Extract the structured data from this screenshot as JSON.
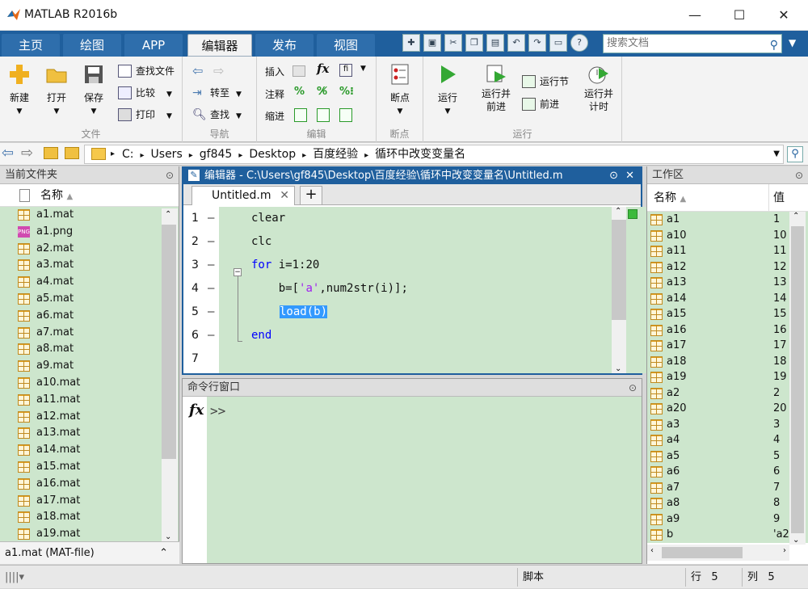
{
  "window": {
    "title": "MATLAB R2016b",
    "minimize": "—",
    "maximize": "☐",
    "close": "✕"
  },
  "tabs": [
    {
      "label": "主页"
    },
    {
      "label": "绘图"
    },
    {
      "label": "APP"
    },
    {
      "label": "编辑器",
      "active": true
    },
    {
      "label": "发布"
    },
    {
      "label": "视图"
    }
  ],
  "search": {
    "placeholder": "搜索文档"
  },
  "ribbon": {
    "file": {
      "section": "文件",
      "new": "新建",
      "open": "打开",
      "save": "保存",
      "find_files": "查找文件",
      "compare": "比较",
      "print": "打印"
    },
    "nav": {
      "section": "导航",
      "goto": "转至",
      "find": "查找"
    },
    "edit": {
      "section": "编辑",
      "insert": "插入",
      "comment": "注释",
      "indent": "缩进"
    },
    "breakpoints": {
      "section": "断点",
      "label": "断点"
    },
    "run": {
      "section": "运行",
      "run": "运行",
      "run_advance": "运行并\n前进",
      "run_section": "运行节",
      "advance": "前进",
      "run_time": "运行并\n计时"
    }
  },
  "path": {
    "segments": [
      "C:",
      "Users",
      "gf845",
      "Desktop",
      "百度经验",
      "循环中改变变量名"
    ]
  },
  "current_folder": {
    "title": "当前文件夹",
    "column": "名称",
    "files": [
      "a1.mat",
      "a1.png",
      "a2.mat",
      "a3.mat",
      "a4.mat",
      "a5.mat",
      "a6.mat",
      "a7.mat",
      "a8.mat",
      "a9.mat",
      "a10.mat",
      "a11.mat",
      "a12.mat",
      "a13.mat",
      "a14.mat",
      "a15.mat",
      "a16.mat",
      "a17.mat",
      "a18.mat",
      "a19.mat"
    ],
    "detail": "a1.mat  (MAT-file)"
  },
  "editor": {
    "header": "编辑器 - C:\\Users\\gf845\\Desktop\\百度经验\\循环中改变变量名\\Untitled.m",
    "tab": "Untitled.m",
    "lines": [
      {
        "n": "1",
        "dash": "—",
        "code": "clear"
      },
      {
        "n": "2",
        "dash": "—",
        "code": "clc"
      },
      {
        "n": "3",
        "dash": "—",
        "kw": "for",
        "code": " i=1:20"
      },
      {
        "n": "4",
        "dash": "—",
        "code": "    b=[",
        "str": "'a'",
        "code2": ",num2str(i)];"
      },
      {
        "n": "5",
        "dash": "—",
        "sel": "load(b)"
      },
      {
        "n": "6",
        "dash": "—",
        "kw": "end"
      },
      {
        "n": "7",
        "dash": "",
        "code": ""
      }
    ]
  },
  "command": {
    "title": "命令行窗口",
    "prompt": ">>",
    "fx": "fx"
  },
  "workspace": {
    "title": "工作区",
    "col_name": "名称",
    "col_value": "值",
    "vars": [
      {
        "name": "a1",
        "value": "1"
      },
      {
        "name": "a10",
        "value": "10"
      },
      {
        "name": "a11",
        "value": "11"
      },
      {
        "name": "a12",
        "value": "12"
      },
      {
        "name": "a13",
        "value": "13"
      },
      {
        "name": "a14",
        "value": "14"
      },
      {
        "name": "a15",
        "value": "15"
      },
      {
        "name": "a16",
        "value": "16"
      },
      {
        "name": "a17",
        "value": "17"
      },
      {
        "name": "a18",
        "value": "18"
      },
      {
        "name": "a19",
        "value": "19"
      },
      {
        "name": "a2",
        "value": "2"
      },
      {
        "name": "a20",
        "value": "20"
      },
      {
        "name": "a3",
        "value": "3"
      },
      {
        "name": "a4",
        "value": "4"
      },
      {
        "name": "a5",
        "value": "5"
      },
      {
        "name": "a6",
        "value": "6"
      },
      {
        "name": "a7",
        "value": "7"
      },
      {
        "name": "a8",
        "value": "8"
      },
      {
        "name": "a9",
        "value": "9"
      },
      {
        "name": "b",
        "value": "'a2"
      }
    ]
  },
  "status": {
    "mode": "脚本",
    "row_label": "行",
    "row": "5",
    "col_label": "列",
    "col": "5"
  }
}
